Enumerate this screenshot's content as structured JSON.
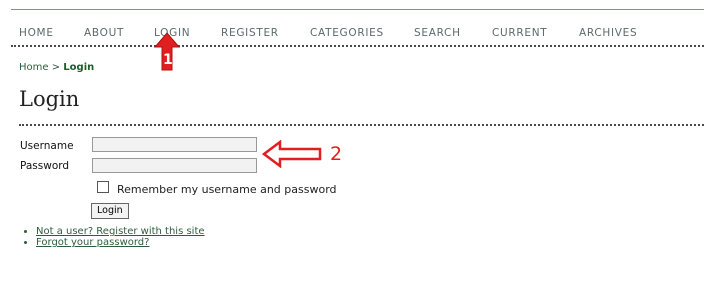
{
  "nav": [
    "HOME",
    "ABOUT",
    "LOGIN",
    "REGISTER",
    "CATEGORIES",
    "SEARCH",
    "CURRENT",
    "ARCHIVES"
  ],
  "breadcrumb": {
    "home": "Home",
    "sep": ">",
    "current": "Login"
  },
  "page_title": "Login",
  "form": {
    "username_label": "Username",
    "password_label": "Password",
    "username_value": "",
    "password_value": "",
    "remember_label": "Remember my username and password",
    "login_button": "Login"
  },
  "links": [
    "Not a user? Register with this site",
    "Forgot your password?"
  ],
  "annotations": {
    "one": "1",
    "two": "2",
    "color": "#e02020"
  }
}
